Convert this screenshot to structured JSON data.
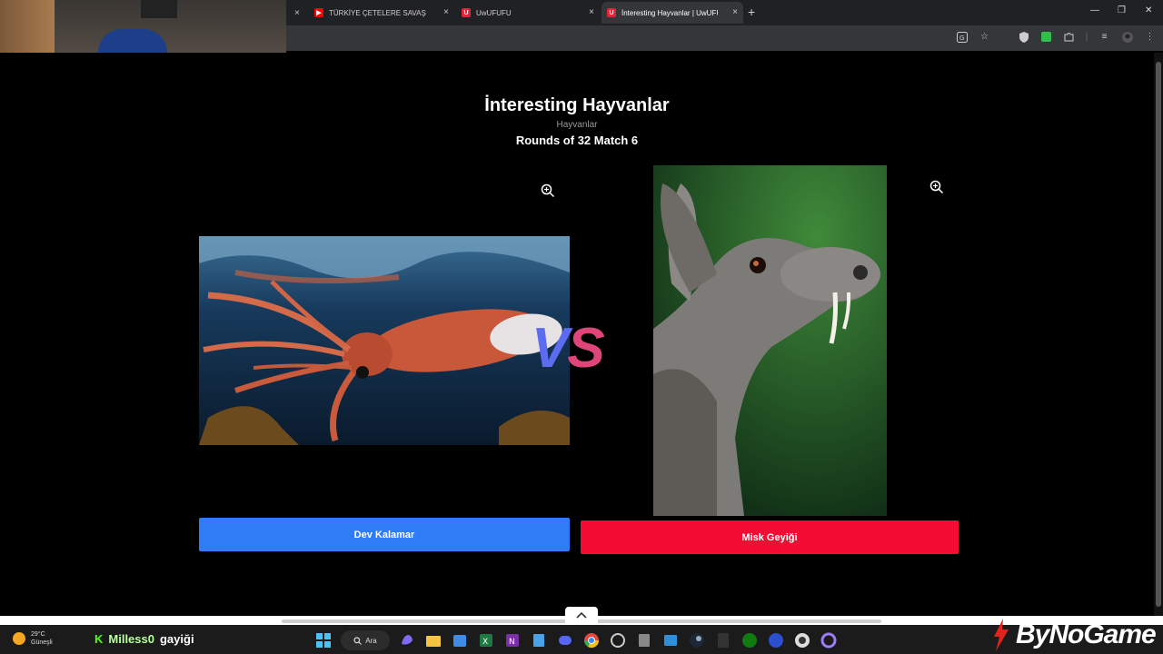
{
  "browser": {
    "tabs": [
      {
        "title": "TÜRKİYE ÇETELERE SAVAŞ AÇTI",
        "favicon": "youtube-icon",
        "active": false
      },
      {
        "title": "UwUFUFU",
        "favicon": "uwufufu-icon",
        "active": false
      },
      {
        "title": "İnteresting Hayvanlar | UwUFUFU",
        "favicon": "uwufufu-icon",
        "active": true
      }
    ],
    "colors": {
      "tabbar": "#202124",
      "toolbar": "#35363a"
    }
  },
  "page": {
    "title": "İnteresting Hayvanlar",
    "subtitle": "Hayvanlar",
    "round_info": "Rounds of 32 Match 6",
    "vs": {
      "v": "V",
      "s": "S"
    },
    "left": {
      "name": "Dev Kalamar",
      "image": "giant-squid-photo",
      "button_color": "#2f7cf6"
    },
    "right": {
      "name": "Misk Geyiği",
      "image": "musk-deer-photo",
      "button_color": "#f30d35"
    }
  },
  "overlay": {
    "kick_icon": "K",
    "streamer_name": "Milless0",
    "chat_word": "gayiği"
  },
  "taskbar": {
    "weather": {
      "temp": "29°C",
      "condition": "Güneşli"
    },
    "search_label": "Ara",
    "apps": [
      "start-icon",
      "search-icon",
      "copilot-icon",
      "folder-icon",
      "store-icon",
      "excel-icon",
      "onenote-icon",
      "notepad-icon",
      "discord-icon",
      "chrome-icon",
      "app-icon",
      "calculator-icon",
      "photos-icon",
      "steam-icon",
      "epic-icon",
      "xbox-icon",
      "ea-icon",
      "obs-icon",
      "app2-icon"
    ]
  },
  "watermark": {
    "text": "ByNoGame"
  }
}
